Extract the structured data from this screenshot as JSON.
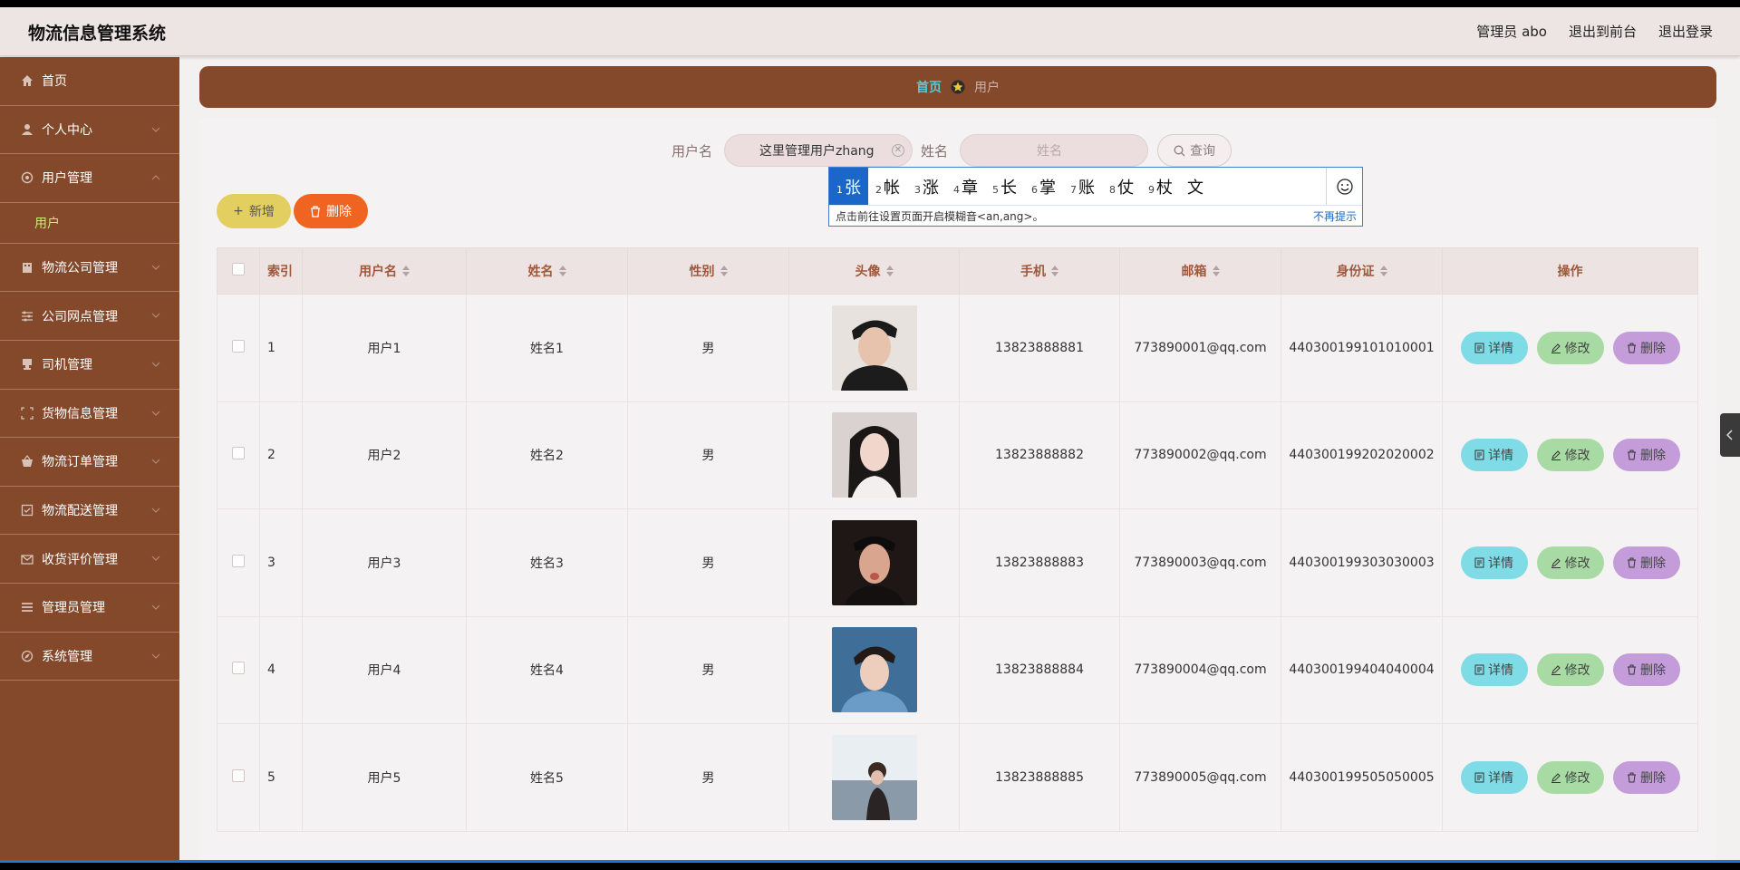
{
  "header": {
    "title": "物流信息管理系统",
    "admin": "管理员 abo",
    "to_front": "退出到前台",
    "logout": "退出登录"
  },
  "sidebar": {
    "items": [
      {
        "label": "首页",
        "icon": "home-icon",
        "expandable": false
      },
      {
        "label": "个人中心",
        "icon": "user-icon",
        "expandable": true
      },
      {
        "label": "用户管理",
        "icon": "gear-icon",
        "expandable": true,
        "expanded": true
      },
      {
        "label": "物流公司管理",
        "icon": "building-icon",
        "expandable": true
      },
      {
        "label": "公司网点管理",
        "icon": "sliders-icon",
        "expandable": true
      },
      {
        "label": "司机管理",
        "icon": "stamp-icon",
        "expandable": true
      },
      {
        "label": "货物信息管理",
        "icon": "scan-icon",
        "expandable": true
      },
      {
        "label": "物流订单管理",
        "icon": "basket-icon",
        "expandable": true
      },
      {
        "label": "物流配送管理",
        "icon": "check-box-icon",
        "expandable": true
      },
      {
        "label": "收货评价管理",
        "icon": "mail-icon",
        "expandable": true
      },
      {
        "label": "管理员管理",
        "icon": "menu-icon",
        "expandable": true
      },
      {
        "label": "系统管理",
        "icon": "compass-icon",
        "expandable": true
      }
    ],
    "sub_item": "用户"
  },
  "breadcrumb": {
    "home": "首页",
    "current": "用户"
  },
  "search": {
    "username_label": "用户名",
    "username_value": "这里管理用户zhang",
    "name_label": "姓名",
    "name_placeholder": "姓名",
    "query_label": "查询"
  },
  "ime": {
    "candidates": [
      "1 张",
      "2 帐",
      "3 涨",
      "4 章",
      "5 长",
      "6 掌",
      "7 账",
      "8 仗",
      "9 杖",
      "文"
    ],
    "hint": "点击前往设置页面开启模糊音<an,ang>。",
    "dismiss": "不再提示"
  },
  "toolbar": {
    "add_label": "新增",
    "delete_label": "删除"
  },
  "table": {
    "columns": [
      "索引",
      "用户名",
      "姓名",
      "性别",
      "头像",
      "手机",
      "邮箱",
      "身份证",
      "操作"
    ],
    "rows": [
      {
        "index": "1",
        "username": "用户1",
        "name": "姓名1",
        "gender": "男",
        "phone": "13823888881",
        "email": "773890001@qq.com",
        "id_card": "440300199101010001"
      },
      {
        "index": "2",
        "username": "用户2",
        "name": "姓名2",
        "gender": "男",
        "phone": "13823888882",
        "email": "773890002@qq.com",
        "id_card": "440300199202020002"
      },
      {
        "index": "3",
        "username": "用户3",
        "name": "姓名3",
        "gender": "男",
        "phone": "13823888883",
        "email": "773890003@qq.com",
        "id_card": "440300199303030003"
      },
      {
        "index": "4",
        "username": "用户4",
        "name": "姓名4",
        "gender": "男",
        "phone": "13823888884",
        "email": "773890004@qq.com",
        "id_card": "440300199404040004"
      },
      {
        "index": "5",
        "username": "用户5",
        "name": "姓名5",
        "gender": "男",
        "phone": "13823888885",
        "email": "773890005@qq.com",
        "id_card": "440300199505050005"
      }
    ],
    "actions": {
      "detail": "详情",
      "edit": "修改",
      "delete": "删除"
    }
  },
  "colors": {
    "brand": "#84482b",
    "accent_cyan": "#58c9d7",
    "add": "#e3cf5f",
    "delete": "#f06422",
    "detail": "#7fdbe5",
    "edit": "#a8dba3",
    "row_delete": "#c39cd9"
  }
}
